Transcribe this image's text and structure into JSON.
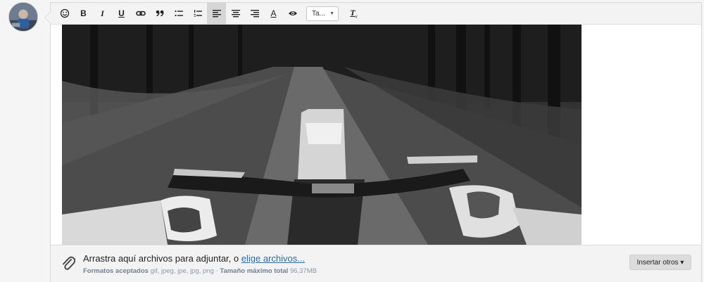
{
  "toolbar": {
    "buttons": [
      {
        "name": "smilie-button",
        "icon": "smile-icon",
        "glyph": "☺"
      },
      {
        "name": "bold-button",
        "icon": "bold-icon",
        "glyph": "B"
      },
      {
        "name": "italic-button",
        "icon": "italic-icon",
        "glyph": "I"
      },
      {
        "name": "underline-button",
        "icon": "underline-icon",
        "glyph": "U"
      },
      {
        "name": "link-button",
        "icon": "link-icon",
        "glyph": "⚭"
      },
      {
        "name": "quote-button",
        "icon": "quote-icon",
        "glyph": "99"
      },
      {
        "name": "bullet-list-button",
        "icon": "bullet-list-icon",
        "glyph": "☰"
      },
      {
        "name": "numbered-list-button",
        "icon": "numbered-list-icon",
        "glyph": "☰"
      },
      {
        "name": "align-left-button",
        "icon": "align-left-icon",
        "glyph": "≡"
      },
      {
        "name": "align-center-button",
        "icon": "align-center-icon",
        "glyph": "≡"
      },
      {
        "name": "align-right-button",
        "icon": "align-right-icon",
        "glyph": "≡"
      },
      {
        "name": "text-color-button",
        "icon": "text-color-icon",
        "glyph": "A"
      },
      {
        "name": "preview-button",
        "icon": "eye-icon",
        "glyph": "👁"
      }
    ],
    "font_size_select": "Ta...",
    "remove_format_glyph": "T"
  },
  "attachments": {
    "drop_text": "Arrastra aquí archivos para adjuntar, o",
    "choose_link": "elige archivos...",
    "formats_label": "Formatos aceptados",
    "formats_value": "gif, jpeg, jpe, jpg, png",
    "separator": "·",
    "max_size_label": "Tamaño máximo total",
    "max_size_value": "96,37MB",
    "insert_button": "Insertar otros ▾"
  },
  "colors": {
    "link": "#2d6ab2",
    "toolbar_bg": "#f3f3f3",
    "active_button": "#d6d6d6"
  }
}
